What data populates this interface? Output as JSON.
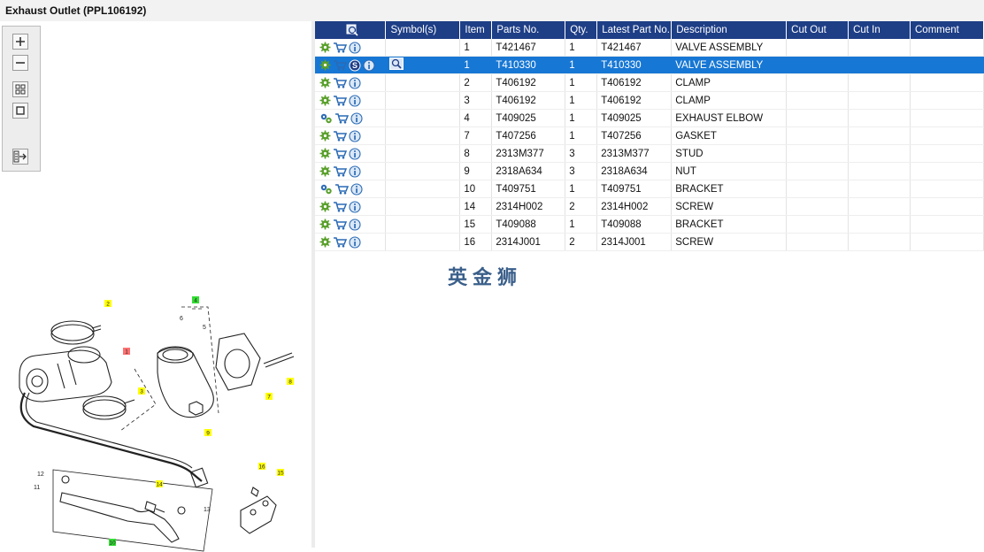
{
  "window": {
    "title": "Exhaust Outlet (PPL106192)"
  },
  "toolbar": {
    "buttons": [
      "zoom-in-icon",
      "zoom-out-icon",
      "fit-all-icon",
      "fit-page-icon",
      "export-icon"
    ]
  },
  "grid": {
    "columns": [
      "",
      "Symbol(s)",
      "Item",
      "Parts No.",
      "Qty.",
      "Latest Part No.",
      "Description",
      "Cut Out",
      "Cut In",
      "Comment"
    ],
    "rows": [
      {
        "icons": [
          "gear",
          "cart",
          "info"
        ],
        "symbols": "",
        "item": "1",
        "part_no": "T421467",
        "qty": "1",
        "latest": "T421467",
        "description": "VALVE ASSEMBLY",
        "cut_out": "",
        "cut_in": "",
        "comment": ""
      },
      {
        "icons": [
          "gear",
          "cart",
          "s-badge",
          "info",
          "magnify"
        ],
        "symbols": "",
        "item": "1",
        "part_no": "T410330",
        "qty": "1",
        "latest": "T410330",
        "description": "VALVE ASSEMBLY",
        "cut_out": "",
        "cut_in": "",
        "comment": "",
        "selected": true
      },
      {
        "icons": [
          "gear",
          "cart",
          "info"
        ],
        "symbols": "",
        "item": "2",
        "part_no": "T406192",
        "qty": "1",
        "latest": "T406192",
        "description": "CLAMP",
        "cut_out": "",
        "cut_in": "",
        "comment": ""
      },
      {
        "icons": [
          "gear",
          "cart",
          "info"
        ],
        "symbols": "",
        "item": "3",
        "part_no": "T406192",
        "qty": "1",
        "latest": "T406192",
        "description": "CLAMP",
        "cut_out": "",
        "cut_in": "",
        "comment": ""
      },
      {
        "icons": [
          "gears",
          "cart",
          "info"
        ],
        "symbols": "",
        "item": "4",
        "part_no": "T409025",
        "qty": "1",
        "latest": "T409025",
        "description": "EXHAUST ELBOW",
        "cut_out": "",
        "cut_in": "",
        "comment": ""
      },
      {
        "icons": [
          "gear",
          "cart",
          "info"
        ],
        "symbols": "",
        "item": "7",
        "part_no": "T407256",
        "qty": "1",
        "latest": "T407256",
        "description": "GASKET",
        "cut_out": "",
        "cut_in": "",
        "comment": ""
      },
      {
        "icons": [
          "gear",
          "cart",
          "info"
        ],
        "symbols": "",
        "item": "8",
        "part_no": "2313M377",
        "qty": "3",
        "latest": "2313M377",
        "description": "STUD",
        "cut_out": "",
        "cut_in": "",
        "comment": ""
      },
      {
        "icons": [
          "gear",
          "cart",
          "info"
        ],
        "symbols": "",
        "item": "9",
        "part_no": "2318A634",
        "qty": "3",
        "latest": "2318A634",
        "description": "NUT",
        "cut_out": "",
        "cut_in": "",
        "comment": ""
      },
      {
        "icons": [
          "gears",
          "cart",
          "info"
        ],
        "symbols": "",
        "item": "10",
        "part_no": "T409751",
        "qty": "1",
        "latest": "T409751",
        "description": "BRACKET",
        "cut_out": "",
        "cut_in": "",
        "comment": ""
      },
      {
        "icons": [
          "gear",
          "cart",
          "info"
        ],
        "symbols": "",
        "item": "14",
        "part_no": "2314H002",
        "qty": "2",
        "latest": "2314H002",
        "description": "SCREW",
        "cut_out": "",
        "cut_in": "",
        "comment": ""
      },
      {
        "icons": [
          "gear",
          "cart",
          "info"
        ],
        "symbols": "",
        "item": "15",
        "part_no": "T409088",
        "qty": "1",
        "latest": "T409088",
        "description": "BRACKET",
        "cut_out": "",
        "cut_in": "",
        "comment": ""
      },
      {
        "icons": [
          "gear",
          "cart",
          "info"
        ],
        "symbols": "",
        "item": "16",
        "part_no": "2314J001",
        "qty": "2",
        "latest": "2314J001",
        "description": "SCREW",
        "cut_out": "",
        "cut_in": "",
        "comment": ""
      }
    ]
  },
  "diagram": {
    "callouts": [
      {
        "label": "2",
        "color": "#ffff00"
      },
      {
        "label": "4",
        "color": "#33dd33"
      },
      {
        "label": "1",
        "color": "#ff7070"
      },
      {
        "label": "3",
        "color": "#ffff00"
      },
      {
        "label": "8",
        "color": "#ffff00"
      },
      {
        "label": "7",
        "color": "#ffff00"
      },
      {
        "label": "9",
        "color": "#ffff00"
      },
      {
        "label": "16",
        "color": "#ffff00"
      },
      {
        "label": "15",
        "color": "#ffff00"
      },
      {
        "label": "14",
        "color": "#ffff00"
      },
      {
        "label": "10",
        "color": "#33dd33"
      }
    ],
    "plain_labels": [
      "6",
      "5",
      "12",
      "11",
      "13"
    ]
  },
  "watermark": "英金狮",
  "colors": {
    "header_bg": "#1e3e86",
    "selected_row": "#1777d4",
    "icon_green": "#5aa02c",
    "icon_blue": "#2a6ab5"
  }
}
